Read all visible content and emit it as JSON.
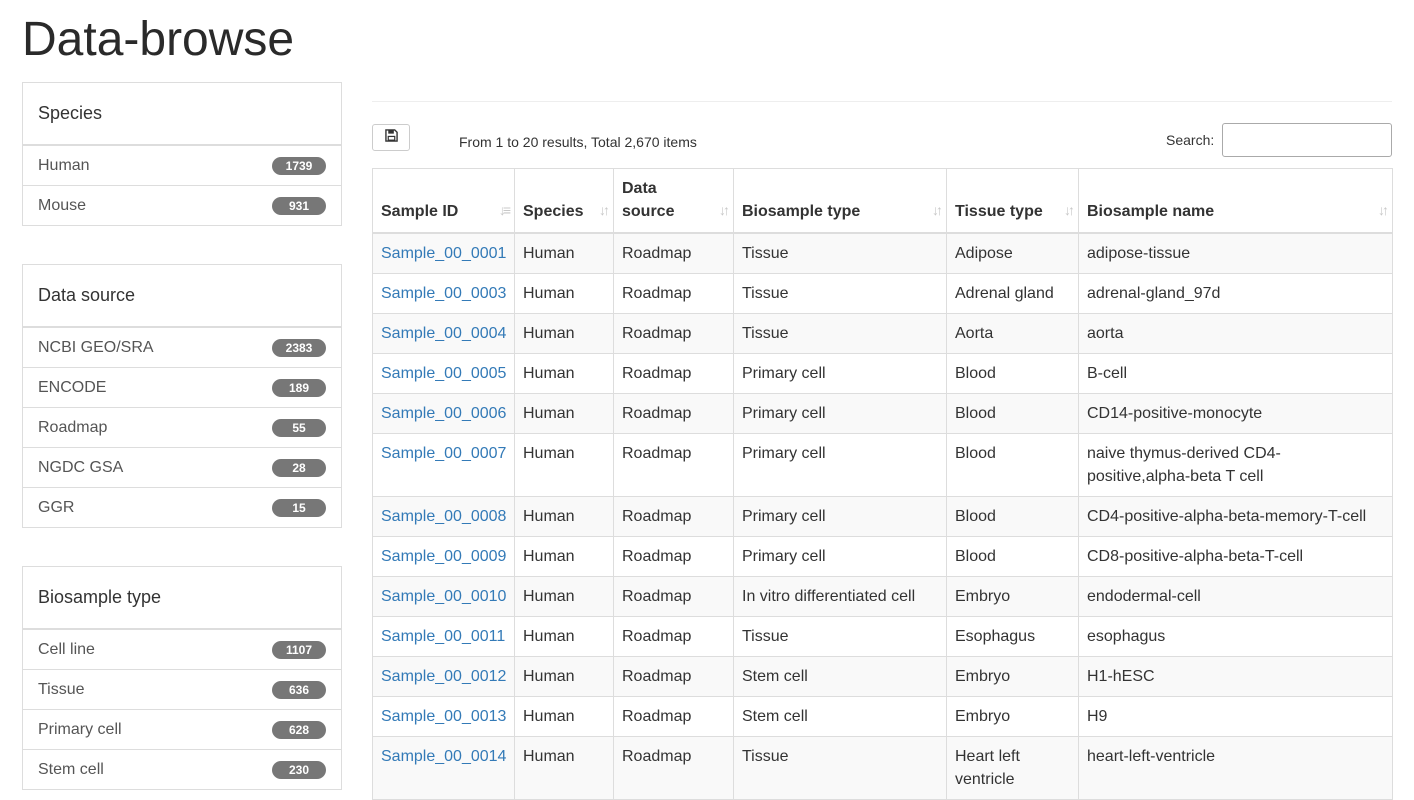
{
  "page": {
    "title": "Data-browse"
  },
  "sidebar": {
    "species": {
      "title": "Species",
      "items": [
        {
          "label": "Human",
          "count": "1739"
        },
        {
          "label": "Mouse",
          "count": "931"
        }
      ]
    },
    "data_source": {
      "title": "Data source",
      "items": [
        {
          "label": "NCBI GEO/SRA",
          "count": "2383"
        },
        {
          "label": "ENCODE",
          "count": "189"
        },
        {
          "label": "Roadmap",
          "count": "55"
        },
        {
          "label": "NGDC GSA",
          "count": "28"
        },
        {
          "label": "GGR",
          "count": "15"
        }
      ]
    },
    "biosample_type": {
      "title": "Biosample type",
      "items": [
        {
          "label": "Cell line",
          "count": "1107"
        },
        {
          "label": "Tissue",
          "count": "636"
        },
        {
          "label": "Primary cell",
          "count": "628"
        },
        {
          "label": "Stem cell",
          "count": "230"
        }
      ]
    }
  },
  "toolbar": {
    "info": "From 1 to 20 results, Total 2,670 items",
    "search_label": "Search:",
    "search_value": ""
  },
  "icons": {
    "save": "floppy-disk-icon",
    "sort": "sort-icon",
    "sort_active": "sort-ascending-icon"
  },
  "table": {
    "headers": [
      "Sample ID",
      "Species",
      "Data source",
      "Biosample type",
      "Tissue type",
      "Biosample name"
    ],
    "rows": [
      [
        "Sample_00_0001",
        "Human",
        "Roadmap",
        "Tissue",
        "Adipose",
        "adipose-tissue"
      ],
      [
        "Sample_00_0003",
        "Human",
        "Roadmap",
        "Tissue",
        "Adrenal gland",
        "adrenal-gland_97d"
      ],
      [
        "Sample_00_0004",
        "Human",
        "Roadmap",
        "Tissue",
        "Aorta",
        "aorta"
      ],
      [
        "Sample_00_0005",
        "Human",
        "Roadmap",
        "Primary cell",
        "Blood",
        "B-cell"
      ],
      [
        "Sample_00_0006",
        "Human",
        "Roadmap",
        "Primary cell",
        "Blood",
        "CD14-positive-monocyte"
      ],
      [
        "Sample_00_0007",
        "Human",
        "Roadmap",
        "Primary cell",
        "Blood",
        "naive thymus-derived CD4-positive,alpha-beta T cell"
      ],
      [
        "Sample_00_0008",
        "Human",
        "Roadmap",
        "Primary cell",
        "Blood",
        "CD4-positive-alpha-beta-memory-T-cell"
      ],
      [
        "Sample_00_0009",
        "Human",
        "Roadmap",
        "Primary cell",
        "Blood",
        "CD8-positive-alpha-beta-T-cell"
      ],
      [
        "Sample_00_0010",
        "Human",
        "Roadmap",
        "In vitro differentiated cell",
        "Embryo",
        "endodermal-cell"
      ],
      [
        "Sample_00_0011",
        "Human",
        "Roadmap",
        "Tissue",
        "Esophagus",
        "esophagus"
      ],
      [
        "Sample_00_0012",
        "Human",
        "Roadmap",
        "Stem cell",
        "Embryo",
        "H1-hESC"
      ],
      [
        "Sample_00_0013",
        "Human",
        "Roadmap",
        "Stem cell",
        "Embryo",
        "H9"
      ],
      [
        "Sample_00_0014",
        "Human",
        "Roadmap",
        "Tissue",
        "Heart left ventricle",
        "heart-left-ventricle"
      ]
    ]
  },
  "colors": {
    "link": "#337ab7",
    "badge": "#777777",
    "border": "#dddddd",
    "stripe": "#f9f9f9"
  }
}
